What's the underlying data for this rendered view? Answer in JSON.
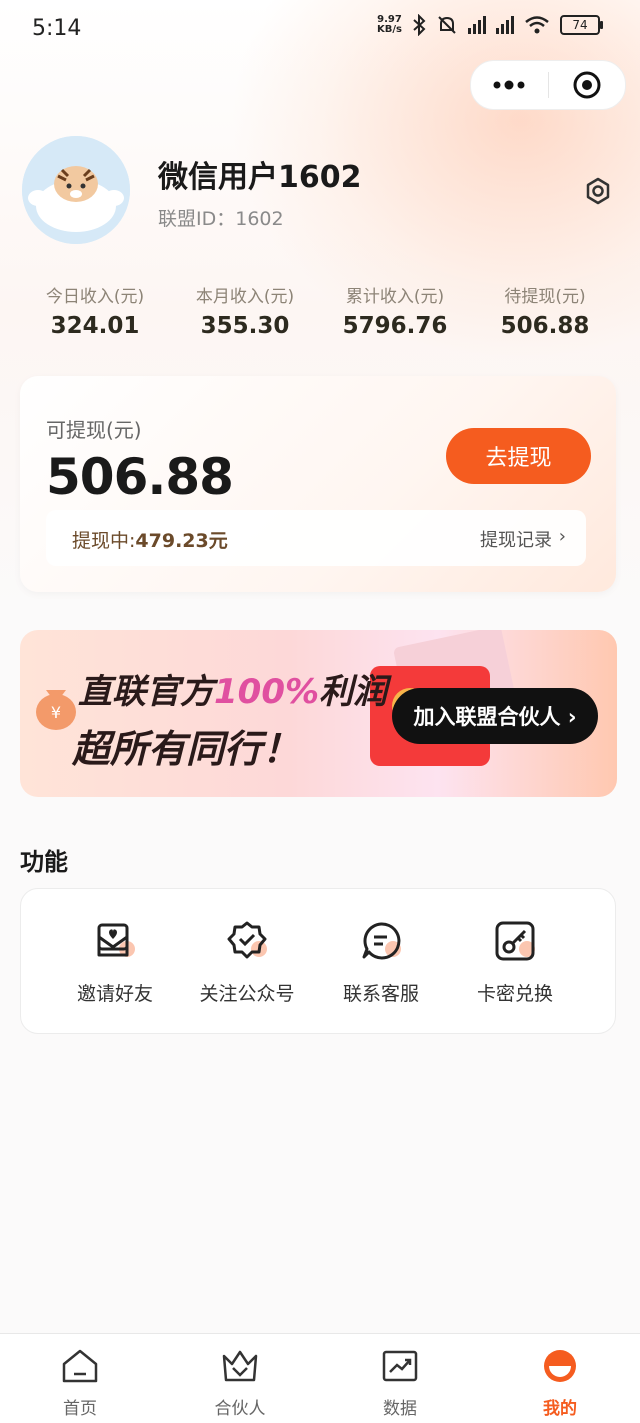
{
  "status_bar": {
    "time": "5:14",
    "net_speed_value": "9.97",
    "net_speed_unit": "KB/s",
    "battery": "74"
  },
  "profile": {
    "username": "微信用户1602",
    "uid_label": "联盟ID：",
    "uid": "1602"
  },
  "stats": [
    {
      "label": "今日收入(元)",
      "value": "324.01"
    },
    {
      "label": "本月收入(元)",
      "value": "355.30"
    },
    {
      "label": "累计收入(元)",
      "value": "5796.76"
    },
    {
      "label": "待提现(元)",
      "value": "506.88"
    }
  ],
  "balance": {
    "label": "可提现(元)",
    "amount": "506.88",
    "withdraw_button": "去提现",
    "pending_label": "提现中:",
    "pending_amount": "479.23元",
    "records_link": "提现记录",
    "records_chevron": "›"
  },
  "banner": {
    "line1_prefix": "直联官方",
    "line1_accent": "100%",
    "line1_suffix": "利润",
    "line2": "超所有同行！",
    "join_button": "加入联盟合伙人 ›"
  },
  "functions": {
    "title": "功能",
    "items": [
      {
        "label": "邀请好友",
        "icon": "invite-envelope-icon"
      },
      {
        "label": "关注公众号",
        "icon": "verified-badge-icon"
      },
      {
        "label": "联系客服",
        "icon": "chat-bubble-icon"
      },
      {
        "label": "卡密兑换",
        "icon": "key-card-icon"
      }
    ]
  },
  "bottom_nav": [
    {
      "label": "首页",
      "icon": "home-icon",
      "active": false
    },
    {
      "label": "合伙人",
      "icon": "partner-crown-icon",
      "active": false
    },
    {
      "label": "数据",
      "icon": "chart-icon",
      "active": false
    },
    {
      "label": "我的",
      "icon": "profile-icon",
      "active": true
    }
  ],
  "colors": {
    "accent": "#f55c1f",
    "banner_accent": "#e050a0"
  }
}
